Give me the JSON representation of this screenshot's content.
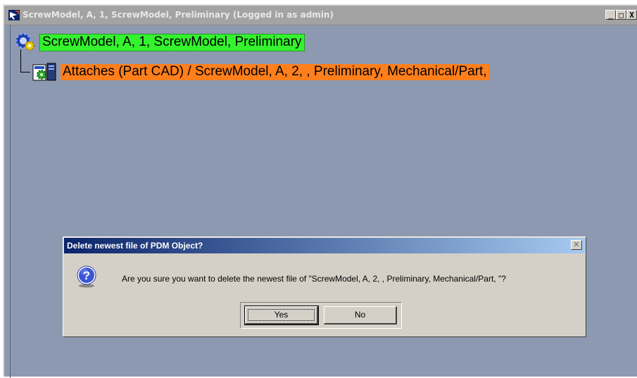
{
  "window": {
    "title": "ScrewModel, A, 1, ScrewModel, Preliminary (Logged in as admin)",
    "controls": [
      "_",
      "□",
      "X"
    ]
  },
  "tree": {
    "root": {
      "label": "ScrewModel, A, 1, ScrewModel, Preliminary",
      "icon": "gear-assembly-icon",
      "highlight_color": "#35f22f"
    },
    "child": {
      "label": "Attaches (Part CAD) / ScrewModel, A, 2, , Preliminary, Mechanical/Part,",
      "icon": "cad-part-document-icon",
      "highlight_color": "#ff7f1c"
    }
  },
  "dialog": {
    "title": "Delete newest file of PDM Object?",
    "close_label": "✕",
    "icon": "question-icon",
    "message": "Are you sure you want to delete the newest file of \"ScrewModel, A, 2, , Preliminary, Mechanical/Part, \"?",
    "yes_label": "Yes",
    "no_label": "No"
  }
}
